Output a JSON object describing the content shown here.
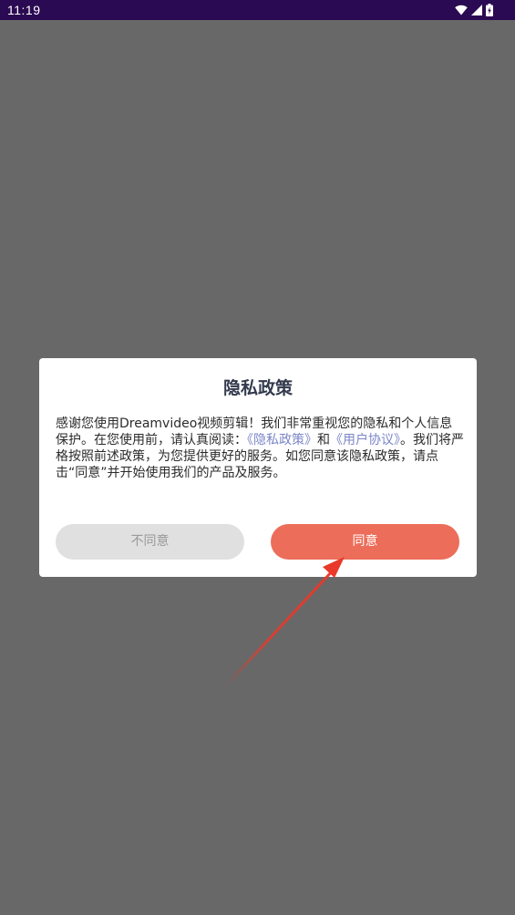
{
  "status_bar": {
    "time": "11:19",
    "background": "#2a0a52"
  },
  "dialog": {
    "title": "隐私政策",
    "body": {
      "text1": "感谢您使用Dreamvideo视频剪辑！我们非常重视您的隐私和个人信息保护。在您使用前，请认真阅读：",
      "link_privacy": "《隐私政策》",
      "connector": "和",
      "link_agreement": "《用户协议》",
      "text2": "。我们将严格按照前述政策，为您提供更好的服务。如您同意该隐私政策，请点击“同意”并开始使用我们的产品及服务。"
    },
    "disagree_label": "不同意",
    "agree_label": "同意"
  },
  "colors": {
    "overlay": "#686868",
    "agree_button": "#ec6d5a",
    "disagree_button": "#e0e0e0",
    "link": "#7b86c8",
    "annotation_arrow": "#e8392a"
  },
  "icons": [
    "wifi-icon",
    "signal-icon",
    "battery-icon"
  ]
}
